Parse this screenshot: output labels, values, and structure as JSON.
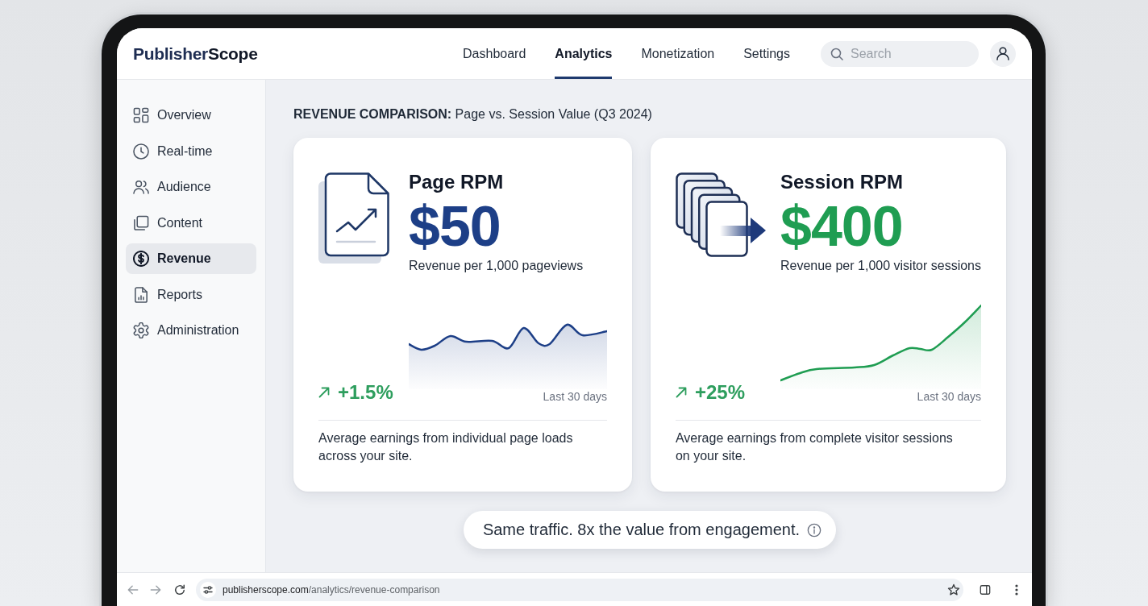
{
  "header": {
    "logo": {
      "first": "Publisher",
      "second": "Scope"
    },
    "nav": [
      {
        "label": "Dashboard",
        "selected": false
      },
      {
        "label": "Analytics",
        "selected": true
      },
      {
        "label": "Monetization",
        "selected": false
      },
      {
        "label": "Settings",
        "selected": false
      }
    ],
    "search": {
      "placeholder": "Search"
    }
  },
  "sidebar": {
    "items": [
      {
        "label": "Overview",
        "selected": false
      },
      {
        "label": "Real-time",
        "selected": false
      },
      {
        "label": "Audience",
        "selected": false
      },
      {
        "label": "Content",
        "selected": false
      },
      {
        "label": "Revenue",
        "selected": true
      },
      {
        "label": "Reports",
        "selected": false
      },
      {
        "label": "Administration",
        "selected": false
      }
    ]
  },
  "main": {
    "heading": "**REVENUE COMPARISON:** Page vs. Session Value (Q3 2024)",
    "cards": [
      {
        "kind": "page",
        "title": "Page RPM",
        "value": "$50",
        "color": "#1d3f87",
        "caption": "Revenue per 1,000 pageviews",
        "change": "+1.5%",
        "period": "Last 30 days",
        "description": "Average earnings from individual page loads across your site."
      },
      {
        "kind": "session",
        "title": "Session RPM",
        "value": "$400",
        "color": "#1f9d52",
        "caption": "Revenue per 1,000 visitor sessions",
        "change": "+25%",
        "period": "Last 30 days",
        "description": "Average earnings from complete visitor sessions on your site."
      }
    ],
    "callout": "Same traffic. 8x the value from engagement."
  },
  "address_bar": {
    "host": "publisherscope.com",
    "path": "/analytics/revenue-comparison"
  }
}
